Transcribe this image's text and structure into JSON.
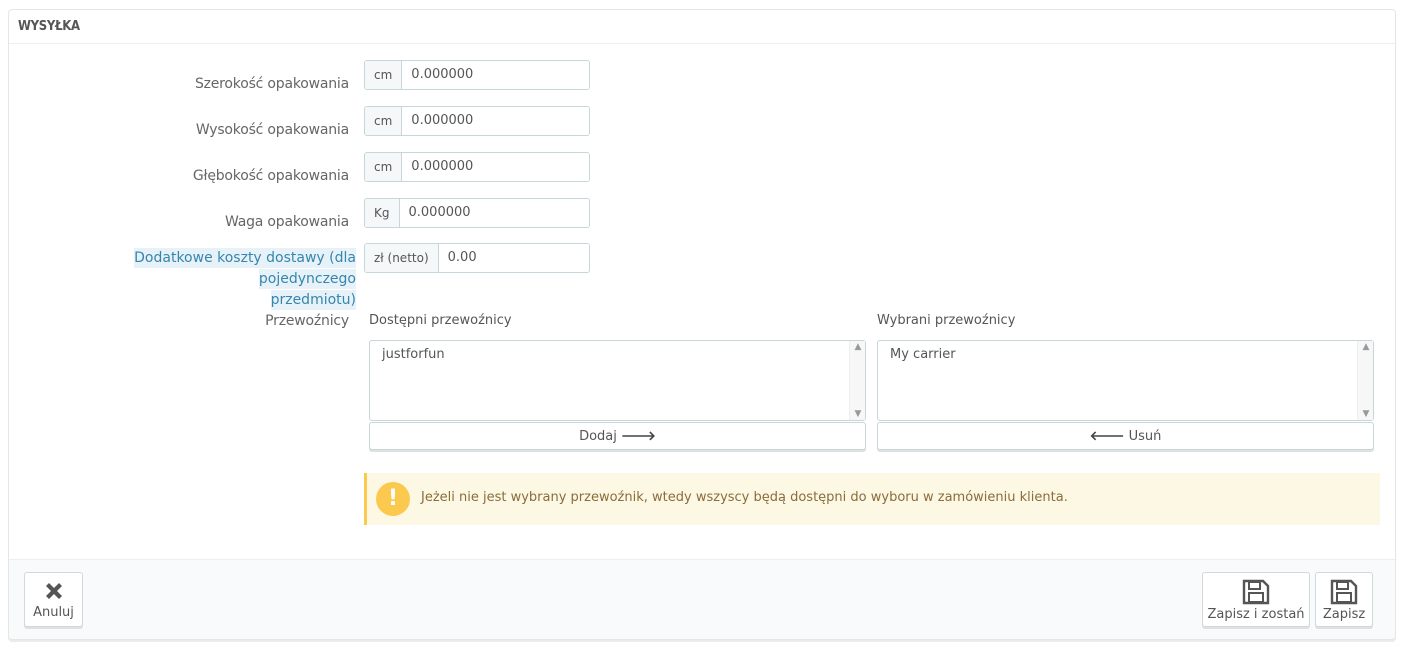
{
  "panel": {
    "title": "WYSYŁKA"
  },
  "fields": {
    "width": {
      "label": "Szerokość opakowania",
      "unit": "cm",
      "value": "0.000000"
    },
    "height": {
      "label": "Wysokość opakowania",
      "unit": "cm",
      "value": "0.000000"
    },
    "depth": {
      "label": "Głębokość opakowania",
      "unit": "cm",
      "value": "0.000000"
    },
    "weight": {
      "label": "Waga opakowania",
      "unit": "Kg",
      "value": "0.000000"
    },
    "extra_cost": {
      "label_line1": "Dodatkowe koszty dostawy (dla pojedynczego",
      "label_line2": "przedmiotu)",
      "unit": "zł (netto)",
      "value": "0.00"
    }
  },
  "carriers": {
    "label": "Przewoźnicy",
    "available": {
      "title": "Dostępni przewoźnicy",
      "items": [
        "justforfun"
      ],
      "button": "Dodaj"
    },
    "selected": {
      "title": "Wybrani przewoźnicy",
      "items": [
        "My carrier"
      ],
      "button": "Usuń"
    }
  },
  "alert": {
    "text": "Jeżeli nie jest wybrany przewoźnik, wtedy wszyscy będą dostępni do wyboru w zamówieniu klienta."
  },
  "footer": {
    "cancel": "Anuluj",
    "save_stay": "Zapisz i zostań",
    "save": "Zapisz"
  },
  "colors": {
    "help_label": "#3586ae",
    "alert_bg": "#fcf8e3",
    "alert_accent": "#fcc94f"
  }
}
